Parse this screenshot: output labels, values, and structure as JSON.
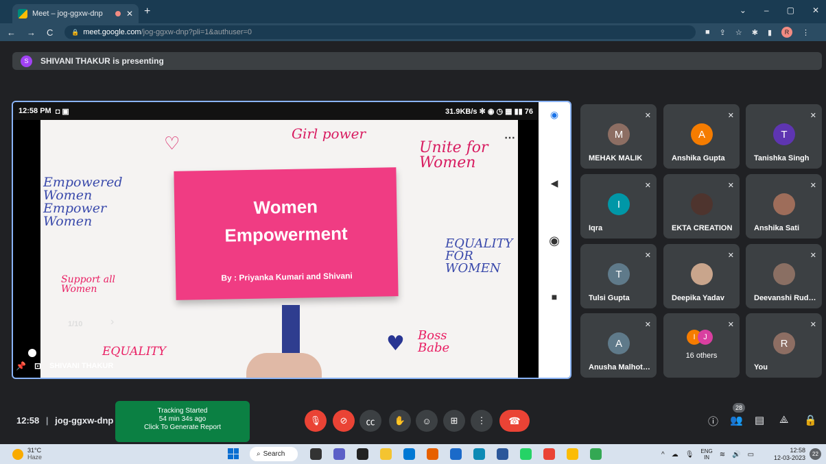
{
  "browser": {
    "tab_title": "Meet – jog-ggxw-dnp",
    "tab_close": "✕",
    "new_tab": "+",
    "url_host": "meet.google.com",
    "url_path": "/jog-ggxw-dnp?pli=1&authuser=0",
    "profile_initial": "R"
  },
  "presenting": {
    "avatar_initial": "S",
    "text": "SHIVANI THAKUR is presenting"
  },
  "phone_status": {
    "time": "12:58 PM",
    "right": "31.9KB/s ✻ ◉ ◷ ▦ ▮▮ 76"
  },
  "slide": {
    "title_line1": "Women",
    "title_line2": "Empowerment",
    "byline": "By : Priyanka Kumari and Shivani",
    "page_indicator": "1/10",
    "doodles": [
      "Girl power",
      "Unite for Women",
      "Empowered Women Empower Women",
      "EQUALITY FOR WOMEN",
      "Support all Women",
      "EQUALITY",
      "Boss Babe"
    ]
  },
  "presenter_label": "SHIVANI THAKUR",
  "participants": [
    {
      "name": "MEHAK MALIK",
      "initial": "M",
      "color": "#8d6e63"
    },
    {
      "name": "Anshika Gupta",
      "initial": "A",
      "color": "#f57c00"
    },
    {
      "name": "Tanishka Singh",
      "initial": "T",
      "color": "#5e35b1"
    },
    {
      "name": "Iqra",
      "initial": "I",
      "color": "#0097a7"
    },
    {
      "name": "EKTA CREATION",
      "initial": "",
      "color": "#4e342e"
    },
    {
      "name": "Anshika Sati",
      "initial": "",
      "color": "#9e6d5a"
    },
    {
      "name": "Tulsi Gupta",
      "initial": "T",
      "color": "#5f7a8a"
    },
    {
      "name": "Deepika Yadav",
      "initial": "",
      "color": "#c9a58c"
    },
    {
      "name": "Deevanshi Rud…",
      "initial": "",
      "color": "#8a6f63"
    },
    {
      "name": "Anusha Malhot…",
      "initial": "A",
      "color": "#5f7a8a"
    },
    {
      "name": "16 others",
      "initial": "",
      "color": "#f57c00"
    },
    {
      "name": "You",
      "initial": "R",
      "color": "#8d6e63"
    }
  ],
  "others_initials": [
    "I",
    "J"
  ],
  "meeting": {
    "time": "12:58",
    "code": "jog-ggxw-dnp",
    "participant_count": "28"
  },
  "tracking": {
    "line1": "Tracking Started",
    "line2": "54 min 34s ago",
    "line3": "Click To Generate Report"
  },
  "taskbar": {
    "temp": "31°C",
    "weather": "Haze",
    "search": "Search",
    "lang1": "ENG",
    "lang2": "IN",
    "time": "12:58",
    "date": "12-03-2023",
    "notif": "22"
  }
}
